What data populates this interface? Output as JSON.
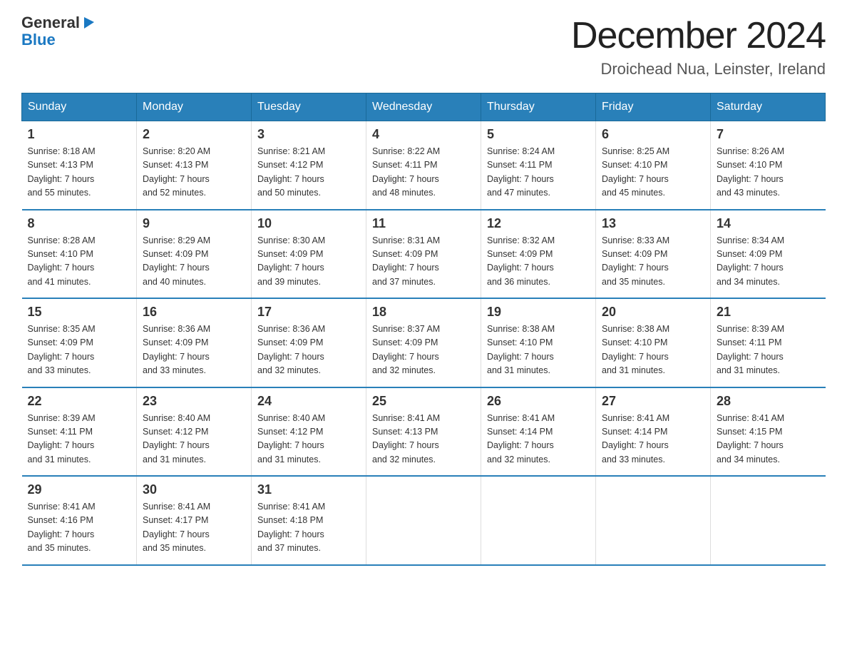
{
  "logo": {
    "general": "General",
    "blue": "Blue",
    "arrow": "▶"
  },
  "title": "December 2024",
  "subtitle": "Droichead Nua, Leinster, Ireland",
  "days_of_week": [
    "Sunday",
    "Monday",
    "Tuesday",
    "Wednesday",
    "Thursday",
    "Friday",
    "Saturday"
  ],
  "weeks": [
    [
      {
        "day": "1",
        "sunrise": "8:18 AM",
        "sunset": "4:13 PM",
        "daylight": "7 hours and 55 minutes."
      },
      {
        "day": "2",
        "sunrise": "8:20 AM",
        "sunset": "4:13 PM",
        "daylight": "7 hours and 52 minutes."
      },
      {
        "day": "3",
        "sunrise": "8:21 AM",
        "sunset": "4:12 PM",
        "daylight": "7 hours and 50 minutes."
      },
      {
        "day": "4",
        "sunrise": "8:22 AM",
        "sunset": "4:11 PM",
        "daylight": "7 hours and 48 minutes."
      },
      {
        "day": "5",
        "sunrise": "8:24 AM",
        "sunset": "4:11 PM",
        "daylight": "7 hours and 47 minutes."
      },
      {
        "day": "6",
        "sunrise": "8:25 AM",
        "sunset": "4:10 PM",
        "daylight": "7 hours and 45 minutes."
      },
      {
        "day": "7",
        "sunrise": "8:26 AM",
        "sunset": "4:10 PM",
        "daylight": "7 hours and 43 minutes."
      }
    ],
    [
      {
        "day": "8",
        "sunrise": "8:28 AM",
        "sunset": "4:10 PM",
        "daylight": "7 hours and 41 minutes."
      },
      {
        "day": "9",
        "sunrise": "8:29 AM",
        "sunset": "4:09 PM",
        "daylight": "7 hours and 40 minutes."
      },
      {
        "day": "10",
        "sunrise": "8:30 AM",
        "sunset": "4:09 PM",
        "daylight": "7 hours and 39 minutes."
      },
      {
        "day": "11",
        "sunrise": "8:31 AM",
        "sunset": "4:09 PM",
        "daylight": "7 hours and 37 minutes."
      },
      {
        "day": "12",
        "sunrise": "8:32 AM",
        "sunset": "4:09 PM",
        "daylight": "7 hours and 36 minutes."
      },
      {
        "day": "13",
        "sunrise": "8:33 AM",
        "sunset": "4:09 PM",
        "daylight": "7 hours and 35 minutes."
      },
      {
        "day": "14",
        "sunrise": "8:34 AM",
        "sunset": "4:09 PM",
        "daylight": "7 hours and 34 minutes."
      }
    ],
    [
      {
        "day": "15",
        "sunrise": "8:35 AM",
        "sunset": "4:09 PM",
        "daylight": "7 hours and 33 minutes."
      },
      {
        "day": "16",
        "sunrise": "8:36 AM",
        "sunset": "4:09 PM",
        "daylight": "7 hours and 33 minutes."
      },
      {
        "day": "17",
        "sunrise": "8:36 AM",
        "sunset": "4:09 PM",
        "daylight": "7 hours and 32 minutes."
      },
      {
        "day": "18",
        "sunrise": "8:37 AM",
        "sunset": "4:09 PM",
        "daylight": "7 hours and 32 minutes."
      },
      {
        "day": "19",
        "sunrise": "8:38 AM",
        "sunset": "4:10 PM",
        "daylight": "7 hours and 31 minutes."
      },
      {
        "day": "20",
        "sunrise": "8:38 AM",
        "sunset": "4:10 PM",
        "daylight": "7 hours and 31 minutes."
      },
      {
        "day": "21",
        "sunrise": "8:39 AM",
        "sunset": "4:11 PM",
        "daylight": "7 hours and 31 minutes."
      }
    ],
    [
      {
        "day": "22",
        "sunrise": "8:39 AM",
        "sunset": "4:11 PM",
        "daylight": "7 hours and 31 minutes."
      },
      {
        "day": "23",
        "sunrise": "8:40 AM",
        "sunset": "4:12 PM",
        "daylight": "7 hours and 31 minutes."
      },
      {
        "day": "24",
        "sunrise": "8:40 AM",
        "sunset": "4:12 PM",
        "daylight": "7 hours and 31 minutes."
      },
      {
        "day": "25",
        "sunrise": "8:41 AM",
        "sunset": "4:13 PM",
        "daylight": "7 hours and 32 minutes."
      },
      {
        "day": "26",
        "sunrise": "8:41 AM",
        "sunset": "4:14 PM",
        "daylight": "7 hours and 32 minutes."
      },
      {
        "day": "27",
        "sunrise": "8:41 AM",
        "sunset": "4:14 PM",
        "daylight": "7 hours and 33 minutes."
      },
      {
        "day": "28",
        "sunrise": "8:41 AM",
        "sunset": "4:15 PM",
        "daylight": "7 hours and 34 minutes."
      }
    ],
    [
      {
        "day": "29",
        "sunrise": "8:41 AM",
        "sunset": "4:16 PM",
        "daylight": "7 hours and 35 minutes."
      },
      {
        "day": "30",
        "sunrise": "8:41 AM",
        "sunset": "4:17 PM",
        "daylight": "7 hours and 35 minutes."
      },
      {
        "day": "31",
        "sunrise": "8:41 AM",
        "sunset": "4:18 PM",
        "daylight": "7 hours and 37 minutes."
      },
      null,
      null,
      null,
      null
    ]
  ],
  "labels": {
    "sunrise": "Sunrise:",
    "sunset": "Sunset:",
    "daylight": "Daylight:"
  },
  "colors": {
    "header_bg": "#2980b9",
    "header_text": "#ffffff",
    "border": "#2980b9"
  }
}
